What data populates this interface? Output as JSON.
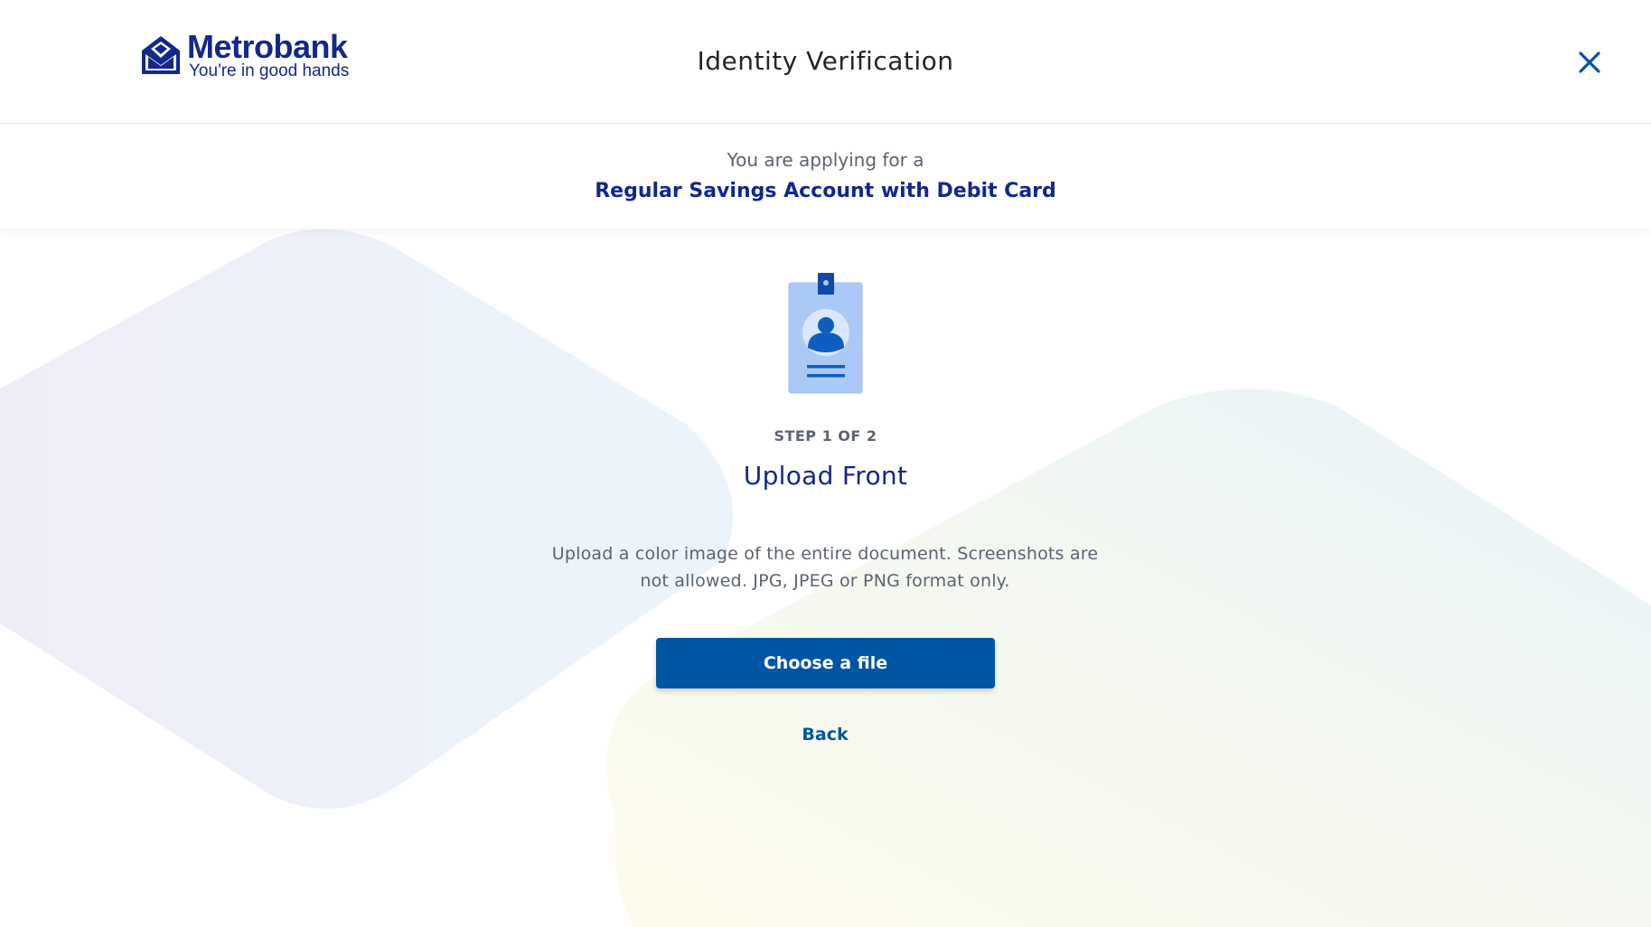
{
  "brand": {
    "name": "Metrobank",
    "tagline": "You're in good hands",
    "color": "#13288a"
  },
  "header": {
    "title": "Identity Verification",
    "close_icon": "close-icon"
  },
  "application": {
    "prefix": "You are applying for a",
    "product": "Regular Savings Account with Debit Card"
  },
  "step": {
    "icon": "id-card-icon",
    "counter": "STEP 1 OF 2",
    "title": "Upload Front",
    "instructions": "Upload a color image of the entire document. Screenshots are not allowed. JPG, JPEG or PNG format only."
  },
  "actions": {
    "choose_file_label": "Choose a file",
    "back_label": "Back"
  },
  "colors": {
    "primary": "#0055a5",
    "heading": "#13288a",
    "muted_text": "#5b6370"
  }
}
